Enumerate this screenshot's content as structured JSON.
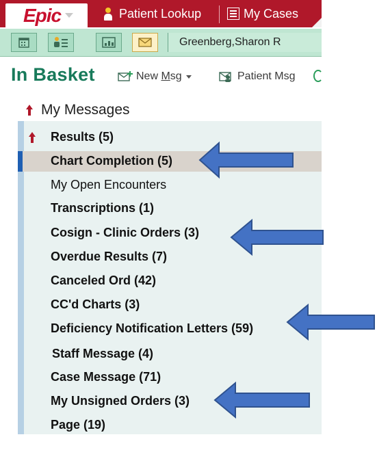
{
  "app": {
    "logo": "Epic",
    "tabs": [
      "Patient Lookup",
      "My Cases"
    ]
  },
  "toolbar": {
    "patient_name": "Greenberg,Sharon R"
  },
  "inbasket": {
    "title": "In Basket",
    "new_msg_prefix": "New ",
    "new_msg_underlined": "M",
    "new_msg_suffix": "sg",
    "patient_msg": "Patient Msg"
  },
  "tree": {
    "root": "My Messages",
    "items": [
      {
        "label": "Results (5)"
      },
      {
        "label": "Chart Completion (5)"
      },
      {
        "label": "My Open Encounters"
      },
      {
        "label": "Transcriptions (1)"
      },
      {
        "label": "Cosign - Clinic Orders (3)"
      },
      {
        "label": "Overdue Results (7)"
      },
      {
        "label": "Canceled Ord (42)"
      },
      {
        "label": "CC'd Charts (3)"
      },
      {
        "label": "Deficiency Notification Letters (59)"
      },
      {
        "label": "Staff Message (4)"
      },
      {
        "label": "Case Message (71)"
      },
      {
        "label": "My Unsigned Orders (3)"
      },
      {
        "label": "Page (19)"
      }
    ]
  },
  "colors": {
    "epic_red": "#b0182a",
    "toolbar_green": "#bfe6d2",
    "title_green": "#177a5a",
    "selection": "#d9d3cc",
    "annotation_arrow": "#4472c4"
  }
}
